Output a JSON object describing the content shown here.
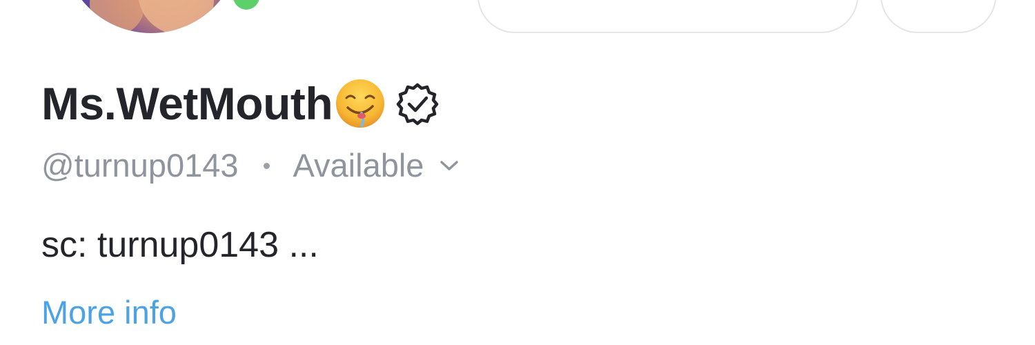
{
  "profile": {
    "display_name": "Ms.WetMouth",
    "emoji": "drooling-face-icon",
    "verified_icon": "verified-badge-icon",
    "handle": "@turnup0143",
    "status": "Available",
    "bio": "sc: turnup0143 ...",
    "more_info_label": "More info",
    "online": true
  },
  "colors": {
    "name_text": "#23252a",
    "secondary_text": "#8f949d",
    "link": "#4ba3e6",
    "online_indicator": "#5cd06b",
    "button_border": "#e3e5e8"
  }
}
